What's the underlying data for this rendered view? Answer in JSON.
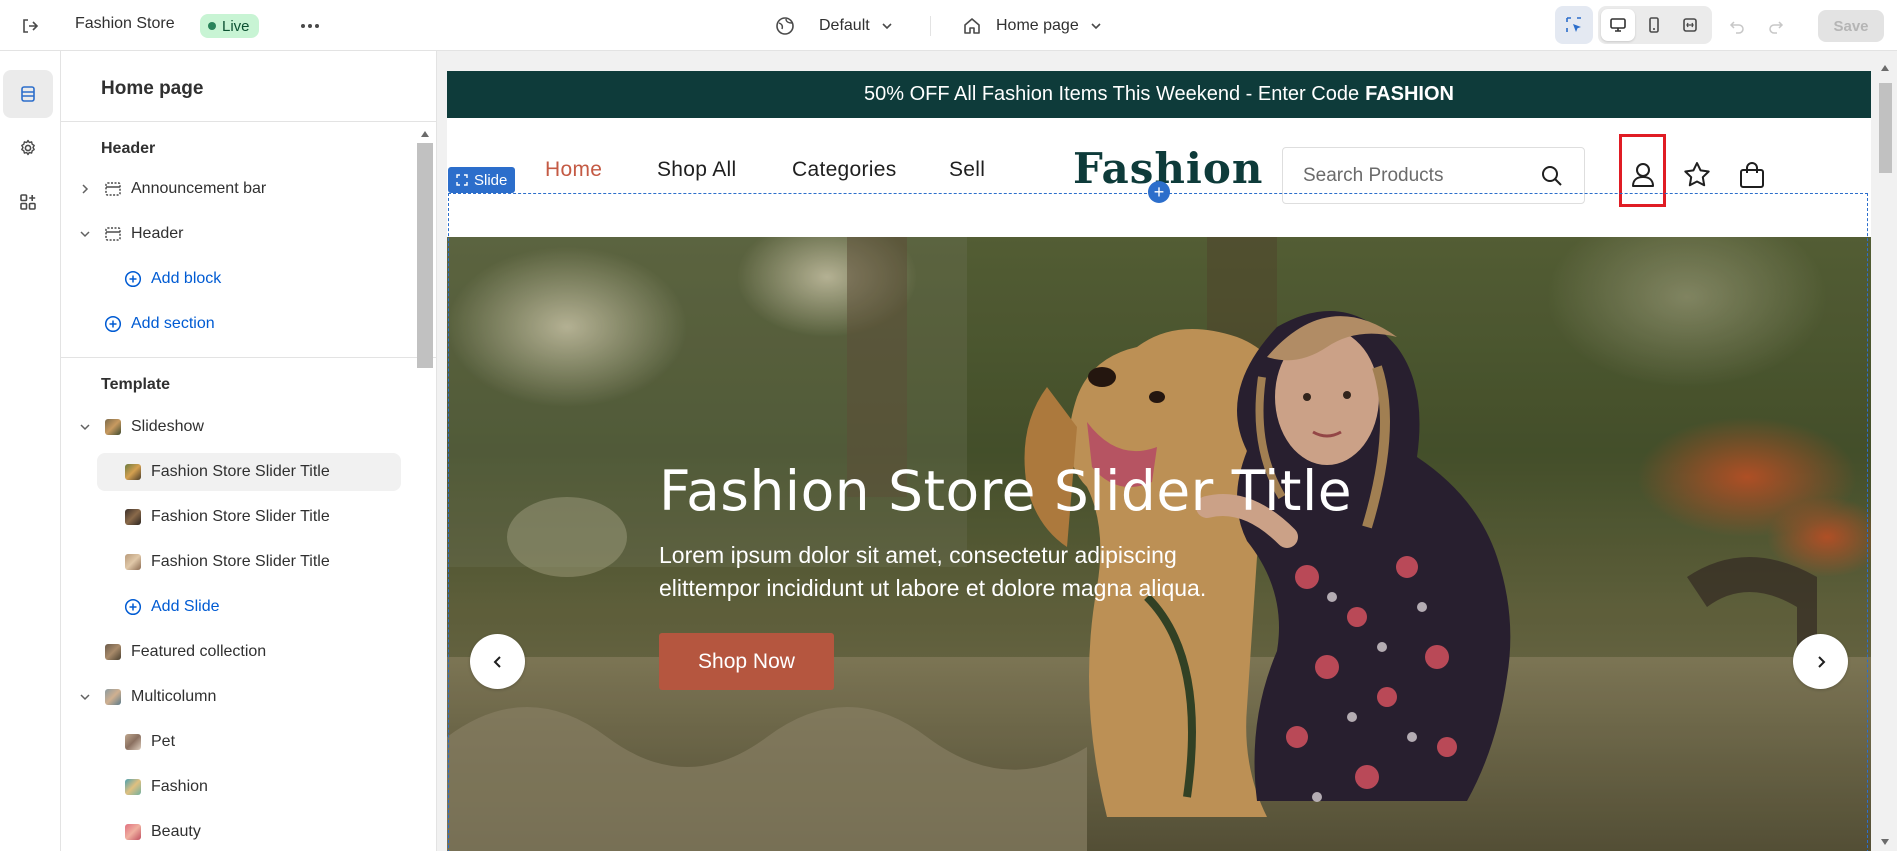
{
  "topbar": {
    "store_name": "Fashion Store",
    "status_badge": "Live",
    "theme_label": "Default",
    "page_label": "Home page",
    "save_label": "Save"
  },
  "sidebar": {
    "title": "Home page",
    "header_group": "Header",
    "header_items": [
      {
        "label": "Announcement bar",
        "icon": "section-icon",
        "expanded": false
      },
      {
        "label": "Header",
        "icon": "section-icon",
        "expanded": true
      }
    ],
    "add_block": "Add block",
    "add_section": "Add section",
    "template_group": "Template",
    "template_items": [
      {
        "label": "Slideshow",
        "expanded": true
      },
      {
        "label": "Fashion Store Slider Title",
        "child": true,
        "selected": true
      },
      {
        "label": "Fashion Store Slider Title",
        "child": true
      },
      {
        "label": "Fashion Store Slider Title",
        "child": true
      },
      {
        "label": "Featured collection"
      },
      {
        "label": "Multicolumn",
        "expanded": true
      },
      {
        "label": "Pet",
        "child": true
      },
      {
        "label": "Fashion",
        "child": true
      },
      {
        "label": "Beauty",
        "child": true
      }
    ],
    "add_slide": "Add Slide"
  },
  "store": {
    "announcement": "50% OFF All Fashion Items This Weekend - Enter Code",
    "announcement_code": "FASHION",
    "nav_links": [
      "Home",
      "Shop All",
      "Categories",
      "Sell"
    ],
    "logo": "Fashion",
    "search_placeholder": "Search Products",
    "slide_tag": "Slide",
    "hero_title": "Fashion Store Slider Title",
    "hero_text": "Lorem ipsum dolor sit amet, consectetur adipiscing elittempor incididunt ut labore et dolore magna aliqua.",
    "hero_button": "Shop Now"
  },
  "colors": {
    "announcement_bg": "#0e3b3a",
    "accent_link": "#c45a44",
    "hero_button": "#b5563f",
    "editor_blue": "#2c6ecb",
    "live_badge_bg": "#c8f4d4"
  }
}
